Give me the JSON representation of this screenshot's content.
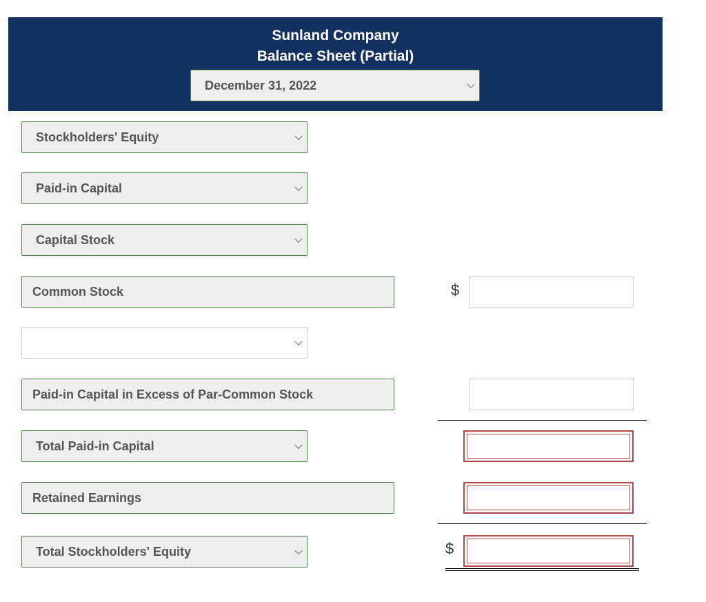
{
  "header": {
    "company": "Sunland Company",
    "statement": "Balance Sheet (Partial)",
    "date_select": "December 31, 2022"
  },
  "rows": [
    {
      "label": "Stockholders' Equity",
      "kind": "dropdown"
    },
    {
      "label": "Paid-in Capital",
      "kind": "dropdown"
    },
    {
      "label": "Capital Stock",
      "kind": "dropdown"
    },
    {
      "label": "Common Stock",
      "kind": "static",
      "currency": "$",
      "amount": ""
    },
    {
      "label": "",
      "kind": "dropdown"
    },
    {
      "label": "Paid-in Capital in Excess of Par-Common Stock",
      "kind": "static",
      "amount": ""
    },
    {
      "label": "Total Paid-in Capital",
      "kind": "dropdown",
      "amount": "",
      "status": "error"
    },
    {
      "label": "Retained Earnings",
      "kind": "static",
      "amount": "",
      "status": "error"
    },
    {
      "label": "Total Stockholders' Equity",
      "kind": "dropdown",
      "currency": "$",
      "amount": "",
      "status": "error"
    }
  ],
  "colors": {
    "header_bg": "#133160",
    "select_border": "#4e8447",
    "error_border": "#b34a4a"
  }
}
